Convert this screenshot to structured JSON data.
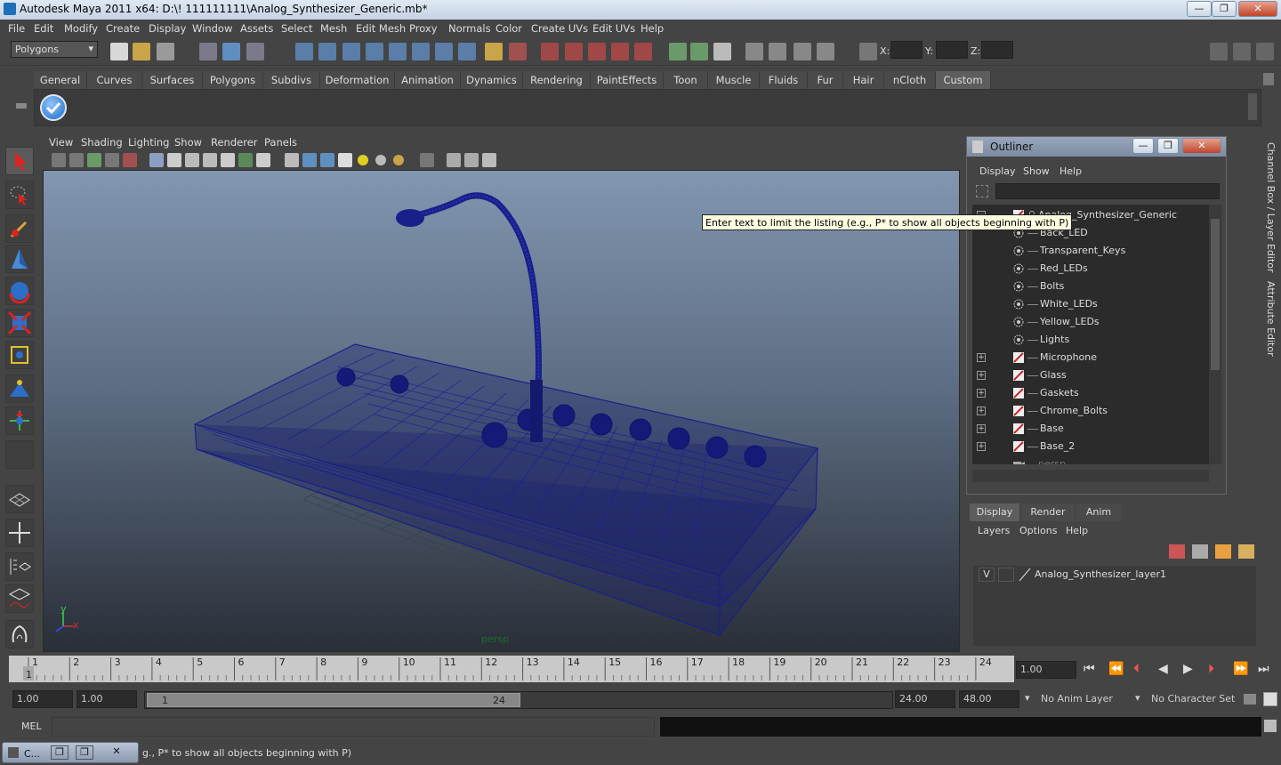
{
  "window": {
    "title": "Autodesk Maya 2011 x64: D:\\! 111111111\\Analog_Synthesizer_Generic.mb*",
    "minimize": "—",
    "restore": "❐",
    "close": "✕"
  },
  "menubar": [
    "File",
    "Edit",
    "Modify",
    "Create",
    "Display",
    "Window",
    "Assets",
    "Select",
    "Mesh",
    "Edit Mesh",
    "Proxy",
    "Normals",
    "Color",
    "Create UVs",
    "Edit UVs",
    "Help"
  ],
  "status_line": {
    "mode": "Polygons",
    "x_label": "X:",
    "y_label": "Y:",
    "z_label": "Z:"
  },
  "shelf_tabs": [
    "General",
    "Curves",
    "Surfaces",
    "Polygons",
    "Subdivs",
    "Deformation",
    "Animation",
    "Dynamics",
    "Rendering",
    "PaintEffects",
    "Toon",
    "Muscle",
    "Fluids",
    "Fur",
    "Hair",
    "nCloth",
    "Custom"
  ],
  "shelf_active_tab": "Custom",
  "viewport": {
    "menu": [
      "View",
      "Shading",
      "Lighting",
      "Show",
      "Renderer",
      "Panels"
    ],
    "camera_label": "persp",
    "axis_y": "y",
    "axis_x": "x"
  },
  "outliner": {
    "title": "Outliner",
    "menu": [
      "Display",
      "Show",
      "Help"
    ],
    "tooltip": "Enter text to limit the listing (e.g., P* to show all objects beginning with P)",
    "items": [
      {
        "label": "Analog_Synthesizer_Generic",
        "expand": "−",
        "icon": "mesh",
        "root": true
      },
      {
        "label": "Back_LED",
        "expand": "",
        "icon": "light"
      },
      {
        "label": "Transparent_Keys",
        "expand": "",
        "icon": "light"
      },
      {
        "label": "Red_LEDs",
        "expand": "",
        "icon": "light"
      },
      {
        "label": "Bolts",
        "expand": "",
        "icon": "light"
      },
      {
        "label": "White_LEDs",
        "expand": "",
        "icon": "light"
      },
      {
        "label": "Yellow_LEDs",
        "expand": "",
        "icon": "light"
      },
      {
        "label": "Lights",
        "expand": "",
        "icon": "light"
      },
      {
        "label": "Microphone",
        "expand": "+",
        "icon": "mesh"
      },
      {
        "label": "Glass",
        "expand": "+",
        "icon": "mesh"
      },
      {
        "label": "Gaskets",
        "expand": "+",
        "icon": "mesh"
      },
      {
        "label": "Chrome_Bolts",
        "expand": "+",
        "icon": "mesh"
      },
      {
        "label": "Base",
        "expand": "+",
        "icon": "mesh"
      },
      {
        "label": "Base_2",
        "expand": "+",
        "icon": "mesh"
      },
      {
        "label": "persp",
        "expand": "",
        "icon": "camera",
        "dim": true
      }
    ]
  },
  "layer_editor": {
    "tabs": [
      "Display",
      "Render",
      "Anim"
    ],
    "active_tab": "Display",
    "menu": [
      "Layers",
      "Options",
      "Help"
    ],
    "layer": {
      "visible": "V",
      "name": "Analog_Synthesizer_layer1"
    }
  },
  "right_strip": {
    "channel_box": "Channel Box / Layer Editor",
    "attribute_editor": "Attribute Editor"
  },
  "time_slider": {
    "ticks": [
      "1",
      "2",
      "3",
      "4",
      "5",
      "6",
      "7",
      "8",
      "9",
      "10",
      "11",
      "12",
      "13",
      "14",
      "15",
      "16",
      "17",
      "18",
      "19",
      "20",
      "21",
      "22",
      "23",
      "24"
    ],
    "current_frame_marker": "1",
    "current_time": "1.00"
  },
  "range_slider": {
    "start_time": "1.00",
    "playback_start": "1.00",
    "range_start_label": "1",
    "range_end_label": "24",
    "playback_end": "24.00",
    "end_time": "48.00",
    "anim_layer": "No Anim Layer",
    "character_set": "No Character Set"
  },
  "command_line": {
    "label": "MEL",
    "input": "",
    "output": ""
  },
  "help_line": {
    "task_label": "C...",
    "text": "g., P* to show all objects beginning with P)"
  },
  "colors": {
    "wireframe": "#1a1f8a",
    "viewport_top": "#8296b0",
    "viewport_bottom": "#2a2f38",
    "active_tab": "#5d5d5d"
  }
}
